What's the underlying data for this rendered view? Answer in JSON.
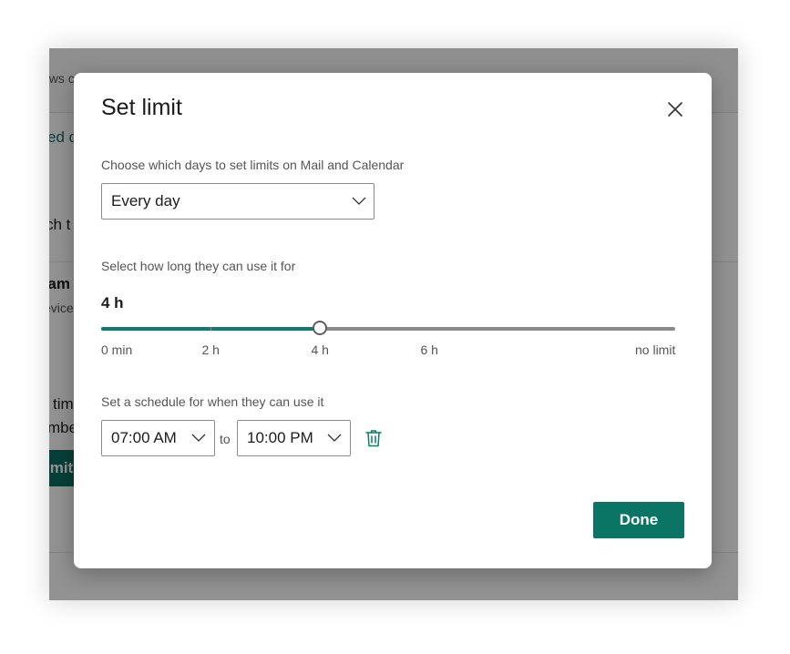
{
  "background": {
    "fragments": {
      "topbar_text": "ows c",
      "link_text": "ed d",
      "text_1": "ch t",
      "title_text": "gam",
      "sub_text": "evice",
      "text_2": "tim",
      "text_3": "mbe",
      "button_text": "imit"
    }
  },
  "dialog": {
    "title": "Set limit",
    "days_label": "Choose which days to set limits on Mail and Calendar",
    "days_selected": "Every day",
    "duration_label": "Select how long they can use it for",
    "duration_value": "4 h",
    "slider": {
      "value_hours": 4,
      "max_hours": 10.5,
      "ticks": [
        {
          "label": "0 min",
          "hours": 0
        },
        {
          "label": "2 h",
          "hours": 2
        },
        {
          "label": "4 h",
          "hours": 4
        },
        {
          "label": "6 h",
          "hours": 6
        },
        {
          "label": "no limit",
          "hours": 10.5
        }
      ]
    },
    "schedule_label": "Set a schedule for when they can use it",
    "schedule_from": "07:00 AM",
    "schedule_to_word": "to",
    "schedule_to": "10:00 PM",
    "done_label": "Done"
  },
  "colors": {
    "accent": "#0b7565",
    "slider_fill": "#0f7b6c",
    "track": "#8a8a8a"
  },
  "icons": {
    "close": "close-icon",
    "dropdown": "chevron-down-icon",
    "delete": "trash-icon"
  }
}
